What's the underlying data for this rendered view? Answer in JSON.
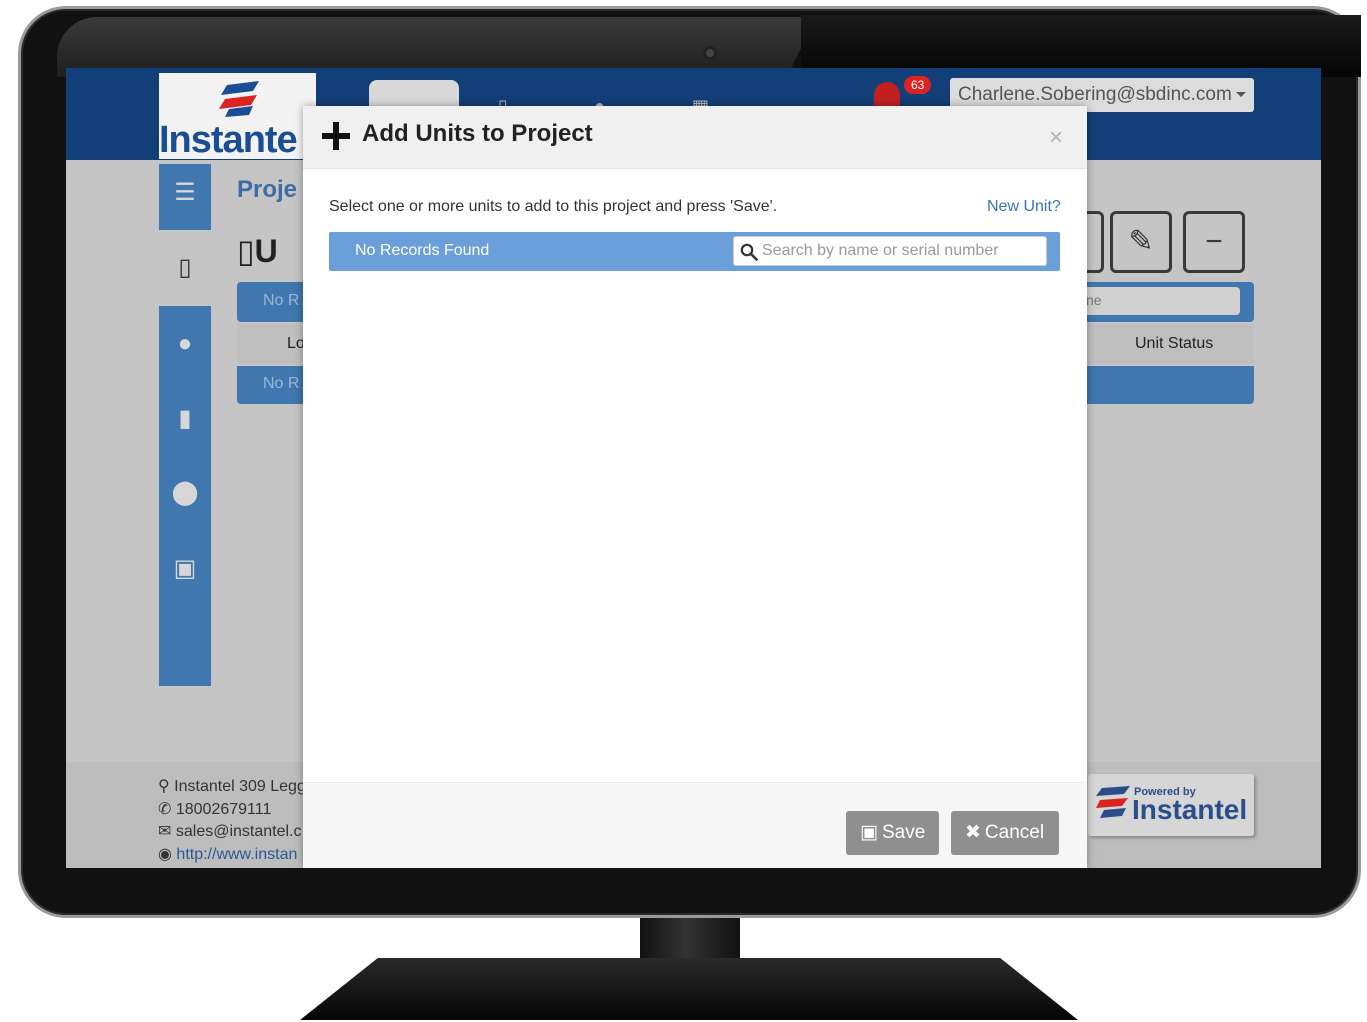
{
  "header": {
    "logo_text": "Instante",
    "notification_count": "63",
    "user_email": "Charlene.Sobering@sbdinc.com"
  },
  "background_page": {
    "page_heading": "Proje",
    "unit_heading": "U",
    "records_text": "No R",
    "search_partial": "ne",
    "col_location": "Lo",
    "col_unit_status": "Unit Status",
    "records_text_2": "No R"
  },
  "footer": {
    "address": "Instantel 309 Legg",
    "phone": "18002679111",
    "email": "sales@instantel.c",
    "website": "http://www.instan",
    "powered_by_small": "Powered by",
    "powered_by_brand": "Instantel"
  },
  "modal": {
    "title": "Add Units to Project",
    "close_glyph": "×",
    "instructions": "Select one or more units to add to this project and press 'Save'.",
    "new_unit_link": "New Unit?",
    "records_status": "No Records Found",
    "search_placeholder": "Search by name or serial number",
    "search_value": "",
    "save_label": "Save",
    "cancel_label": "Cancel"
  },
  "icons": {
    "save": "floppy-disk-icon",
    "cancel": "x-icon",
    "search": "magnifier-icon",
    "title": "plus-icon"
  },
  "colors": {
    "header_bg": "#123f77",
    "accent_blue": "#3f77ae",
    "records_bar": "#6a9fd9",
    "link": "#3575bd",
    "button_gray": "#8f8f8f",
    "notification_red": "#dd2222"
  }
}
